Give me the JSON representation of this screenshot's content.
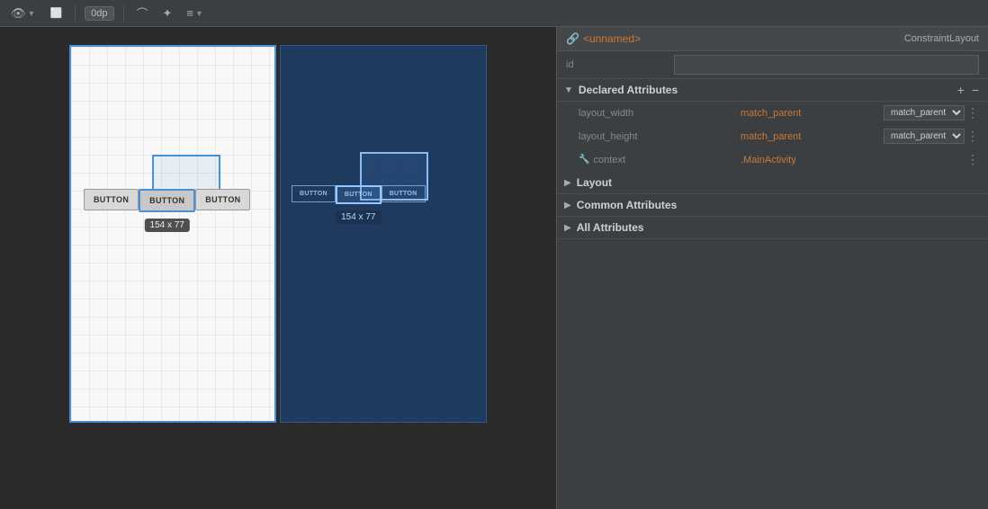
{
  "toolbar": {
    "eye_icon": "👁",
    "badge_label": "0dp",
    "tools": [
      "curve",
      "magic",
      "align"
    ]
  },
  "right_panel": {
    "header": {
      "title": "<unnamed>",
      "title_prefix": "🔗",
      "layout_label": "ConstraintLayout"
    },
    "id_label": "id",
    "id_placeholder": "",
    "sections": {
      "declared": {
        "label": "Declared Attributes",
        "arrow": "▼",
        "plus": "+",
        "minus": "−",
        "attributes": [
          {
            "name": "layout_width",
            "value": "match_parent"
          },
          {
            "name": "layout_height",
            "value": "match_parent"
          }
        ]
      },
      "context": {
        "label": "context",
        "value": ".MainActivity",
        "icon": "🔧"
      },
      "layout": {
        "label": "Layout",
        "arrow": "▶"
      },
      "common": {
        "label": "Common Attributes",
        "arrow": "▶"
      },
      "all": {
        "label": "All Attributes",
        "arrow": "▶"
      }
    }
  },
  "design": {
    "buttons": [
      "BUTTON",
      "BUTTON",
      "BUTTON"
    ],
    "size_tooltip": "154 x 77"
  },
  "blueprint": {
    "buttons": [
      "BUTTON",
      "BUTTON",
      "BUTTON"
    ],
    "size_tooltip": "154 x 77"
  }
}
